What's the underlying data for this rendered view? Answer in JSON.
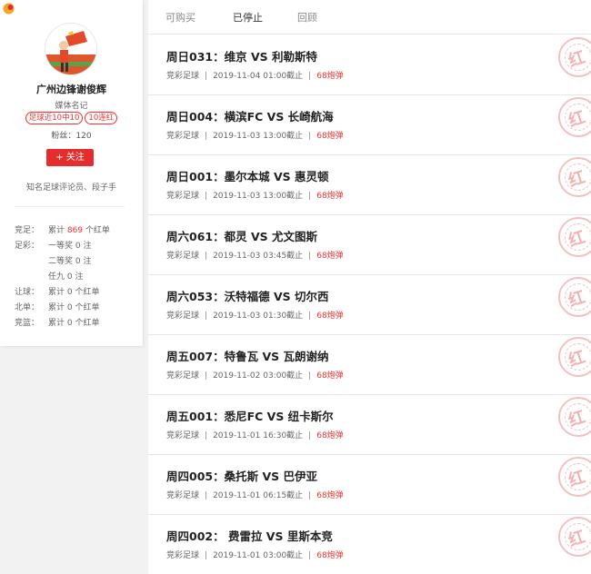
{
  "profile": {
    "name": "广州边锋谢俊辉",
    "title": "媒体名记",
    "badges": [
      "足球近10中10",
      "10连红"
    ],
    "fans": "粉丝：120",
    "follow_label": "+ 关注",
    "bio": "知名足球评论员、段子手",
    "stats": [
      {
        "label": "竞足：",
        "prefix": "累计 ",
        "highlight": "869",
        "suffix": " 个红单"
      },
      {
        "label": "足彩：",
        "prefix": "一等奖 0 注",
        "highlight": "",
        "suffix": ""
      },
      {
        "label": "",
        "prefix": "二等奖 0 注",
        "highlight": "",
        "suffix": ""
      },
      {
        "label": "",
        "prefix": "任九 0 注",
        "highlight": "",
        "suffix": ""
      },
      {
        "label": "让球：",
        "prefix": "累计 0 个红单",
        "highlight": "",
        "suffix": ""
      },
      {
        "label": "北单：",
        "prefix": "累计 0 个红单",
        "highlight": "",
        "suffix": ""
      },
      {
        "label": "竞篮：",
        "prefix": "累计 0 个红单",
        "highlight": "",
        "suffix": ""
      }
    ]
  },
  "tabs": [
    {
      "label": "可购买",
      "active": false
    },
    {
      "label": "已停止",
      "active": true
    },
    {
      "label": "回顾",
      "active": false
    }
  ],
  "items": [
    {
      "title": "周日031：维京 VS 利勒斯特",
      "category": "竞彩足球",
      "deadline": "2019-11-04 01:00截止",
      "price": "68炮弹",
      "stamp": "红"
    },
    {
      "title": "周日004：横滨FC VS 长崎航海",
      "category": "竞彩足球",
      "deadline": "2019-11-03 13:00截止",
      "price": "68炮弹",
      "stamp": "红"
    },
    {
      "title": "周日001：墨尔本城 VS 惠灵顿",
      "category": "竞彩足球",
      "deadline": "2019-11-03 13:00截止",
      "price": "68炮弹",
      "stamp": "红"
    },
    {
      "title": "周六061：都灵 VS 尤文图斯",
      "category": "竞彩足球",
      "deadline": "2019-11-03 03:45截止",
      "price": "68炮弹",
      "stamp": "红"
    },
    {
      "title": "周六053：沃特福德 VS 切尔西",
      "category": "竞彩足球",
      "deadline": "2019-11-03 01:30截止",
      "price": "68炮弹",
      "stamp": "红"
    },
    {
      "title": "周五007：特鲁瓦 VS 瓦朗谢纳",
      "category": "竞彩足球",
      "deadline": "2019-11-02 03:00截止",
      "price": "68炮弹",
      "stamp": "红"
    },
    {
      "title": "周五001：悉尼FC VS 纽卡斯尔",
      "category": "竞彩足球",
      "deadline": "2019-11-01 16:30截止",
      "price": "68炮弹",
      "stamp": "红"
    },
    {
      "title": "周四005：桑托斯 VS 巴伊亚",
      "category": "竞彩足球",
      "deadline": "2019-11-01 06:15截止",
      "price": "68炮弹",
      "stamp": "红"
    },
    {
      "title": "周四002： 费雷拉 VS 里斯本竞",
      "category": "竞彩足球",
      "deadline": "2019-11-01 03:00截止",
      "price": "68炮弹",
      "stamp": "红"
    }
  ],
  "colors": {
    "accent": "#e52d2d",
    "stamp": "#f0a5a5"
  }
}
